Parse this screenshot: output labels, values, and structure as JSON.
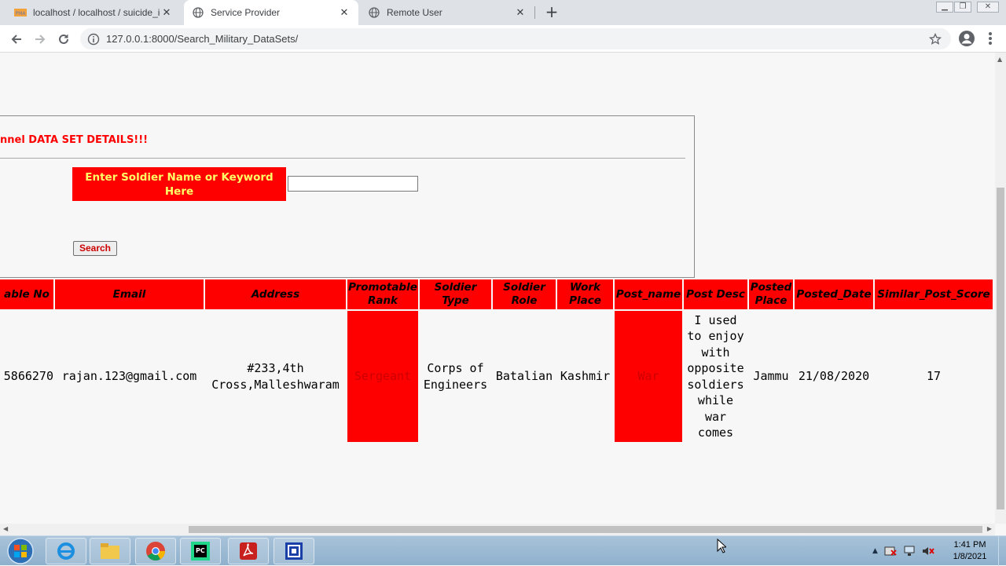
{
  "browser": {
    "tabs": [
      {
        "label": "localhost / localhost / suicide_ide",
        "active": false
      },
      {
        "label": "Service Provider",
        "active": true
      },
      {
        "label": "Remote User",
        "active": false
      }
    ],
    "url": "127.0.0.1:8000/Search_Military_DataSets/"
  },
  "panel": {
    "title": "nnel DATA SET DETAILS!!!",
    "label": "Enter Soldier Name or Keyword Here",
    "search_value": "",
    "search_button": "Search"
  },
  "table": {
    "headers": [
      "able No",
      "Email",
      "Address",
      "Promotable Rank",
      "Soldier Type",
      "Soldier Role",
      "Work Place",
      "Post_name",
      "Post Desc",
      "Posted Place",
      "Posted_Date",
      "Similar_Post_Score"
    ],
    "row": [
      "5866270",
      "rajan.123@gmail.com",
      "#233,4th Cross,Malleshwaram",
      "Sergeant",
      "Corps of Engineers",
      "Batalian",
      "Kashmir",
      "War",
      "I used to enjoy with opposite soldiers while war comes",
      "Jammu",
      "21/08/2020",
      "17"
    ]
  },
  "taskbar": {
    "time": "1:41 PM",
    "date": "1/8/2021"
  },
  "colors": {
    "accent_red": "#ff0000",
    "label_text": "#ffff66"
  }
}
